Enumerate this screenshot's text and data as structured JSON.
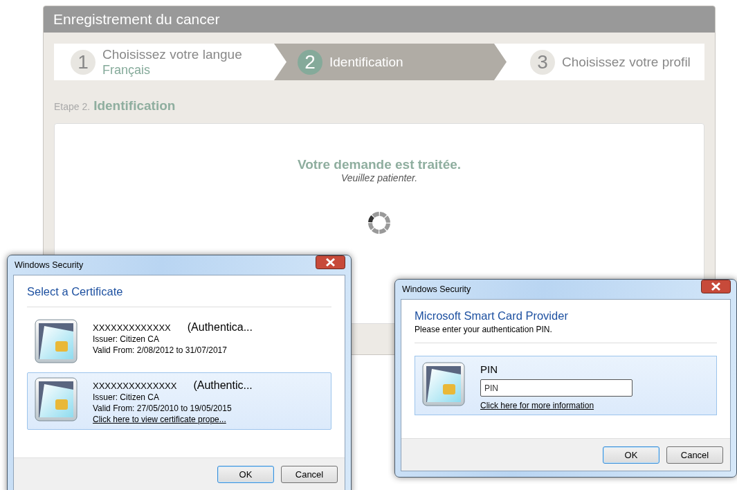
{
  "web_app": {
    "title": "Enregistrement du cancer",
    "steps": [
      {
        "number": "1",
        "label": "Choisissez votre langue",
        "value": "Français",
        "selected": false
      },
      {
        "number": "2",
        "label": "Identification",
        "selected": true
      },
      {
        "number": "3",
        "label": "Choisissez votre profil",
        "selected": false
      }
    ],
    "step_heading": {
      "prefix": "Etape 2.",
      "title": "Identification"
    },
    "message": {
      "title": "Votre demande est traitée.",
      "subtitle": "Veuillez patienter."
    }
  },
  "certificate_dialog": {
    "title": "Windows Security",
    "heading": "Select a Certificate",
    "certificates": [
      {
        "name": "XXXXXXXXXXXXX",
        "purpose": "(Authentica...",
        "issuer": "Issuer: Citizen CA",
        "validity": "Valid From: 2/08/2012 to 31/07/2017",
        "selected": false
      },
      {
        "name": "XXXXXXXXXXXXXX",
        "purpose": "(Authentic...",
        "issuer": "Issuer: Citizen CA",
        "validity": "Valid From: 27/05/2010 to 19/05/2015",
        "link": "Click here to view certificate prope...",
        "selected": true
      }
    ],
    "buttons": [
      {
        "label": "OK",
        "default": true
      },
      {
        "label": "Cancel",
        "default": false
      }
    ]
  },
  "pin_dialog": {
    "title": "Windows Security",
    "heading": "Microsoft Smart Card Provider",
    "instruction": "Please enter your authentication PIN.",
    "field_label": "PIN",
    "placeholder": "PIN",
    "link": "Click here for more information",
    "buttons": [
      {
        "label": "OK",
        "default": true
      },
      {
        "label": "Cancel",
        "default": false
      }
    ]
  }
}
